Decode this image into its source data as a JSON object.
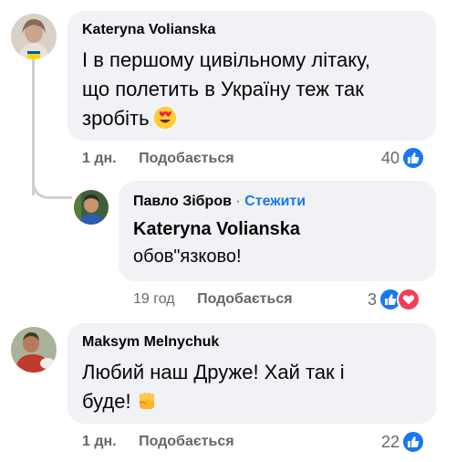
{
  "comments": [
    {
      "author": "Kateryna Volianska",
      "text_line1": "І в першому цивільному літаку,",
      "text_line2": "що полетить в Україну теж так",
      "text_line3": "зробіть",
      "emoji": "heart-eyes",
      "time": "1 дн.",
      "like_label": "Подобається",
      "reaction_count": "40"
    },
    {
      "author": "Павло Зібров",
      "separator": "·",
      "follow_label": "Стежити",
      "mention": "Kateryna Volianska",
      "text": "обов\"язково!",
      "time": "19 год",
      "like_label": "Подобається",
      "reaction_count": "3"
    },
    {
      "author": "Maksym Melnychuk",
      "text_line1": "Любий наш Друже! Хай так і",
      "text_line2": "буде!",
      "emoji": "raised-fist",
      "time": "1 дн.",
      "like_label": "Подобається",
      "reaction_count": "22"
    }
  ],
  "colors": {
    "bubble": "#f0f2f5",
    "link": "#1877f2",
    "meta": "#65676b",
    "like": "#1877f2",
    "love": "#f33e58"
  }
}
